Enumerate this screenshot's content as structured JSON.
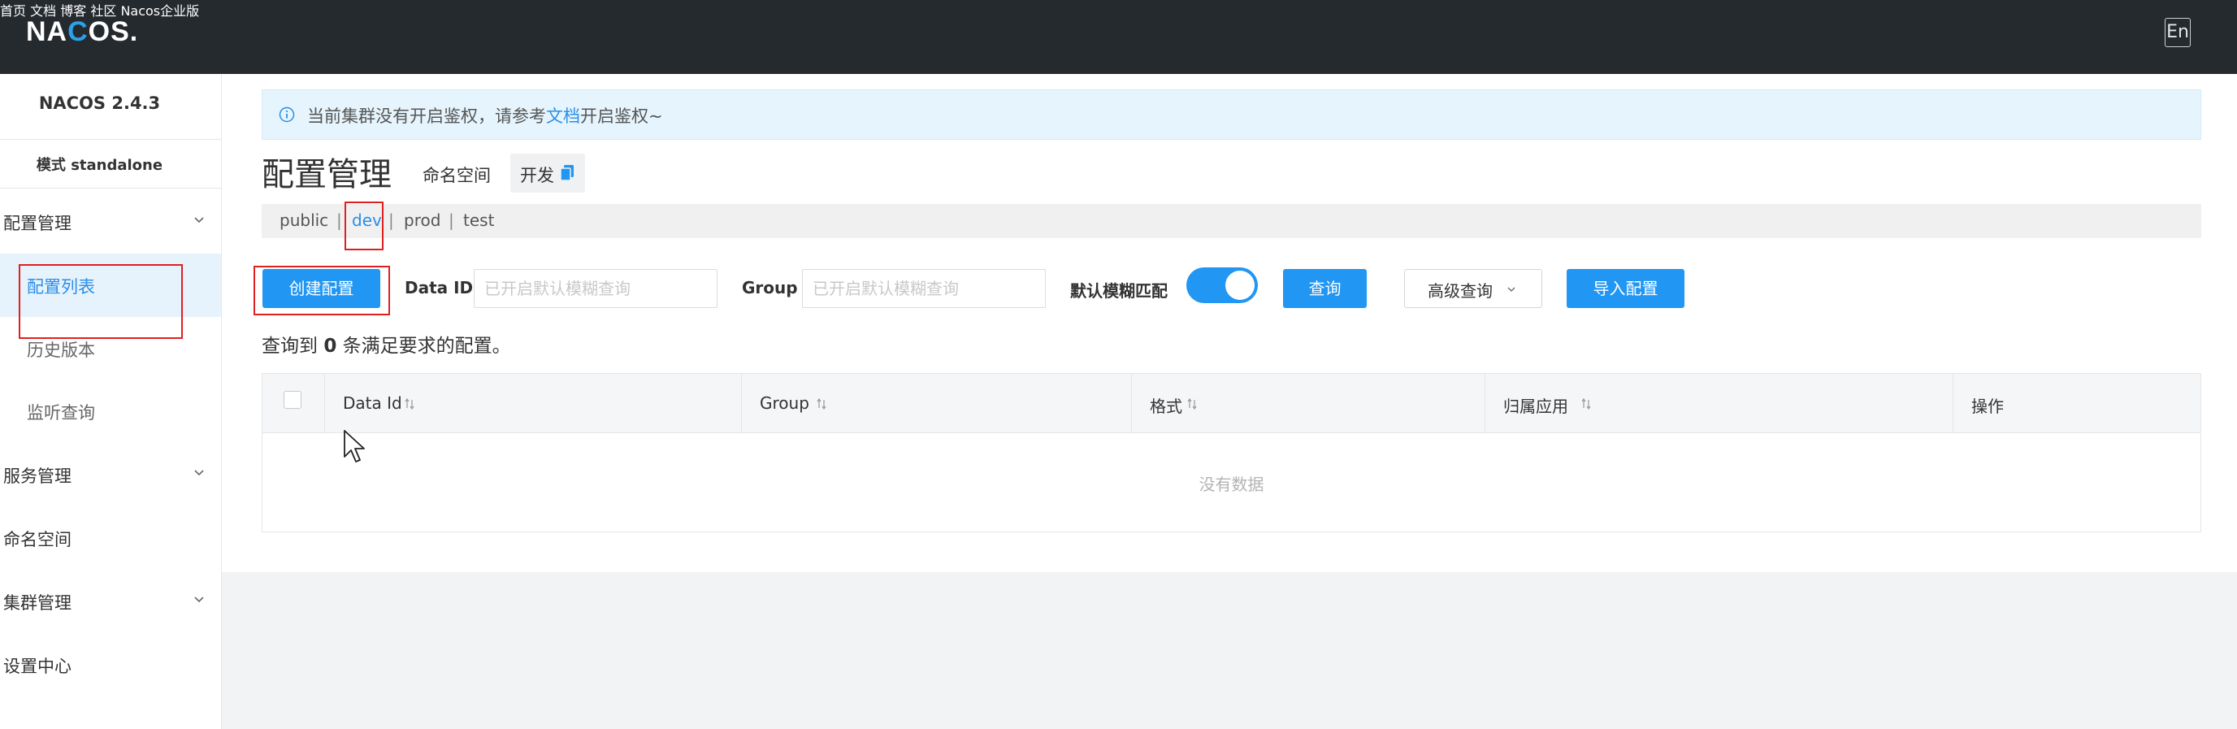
{
  "header": {
    "logo": "NACOS.",
    "logo_parts": [
      "NA",
      "C",
      "OS."
    ],
    "nav": [
      "首页",
      "文档",
      "博客",
      "社区",
      "Nacos企业版"
    ],
    "lang": "En"
  },
  "sidebar": {
    "version": "NACOS 2.4.3",
    "mode": "模式 standalone",
    "items": [
      {
        "label": "配置管理",
        "children": [
          "配置列表",
          "历史版本",
          "监听查询"
        ]
      },
      {
        "label": "服务管理"
      },
      {
        "label": "命名空间"
      },
      {
        "label": "集群管理"
      },
      {
        "label": "设置中心"
      }
    ],
    "active_item": "配置列表"
  },
  "notice": {
    "text_before": "当前集群没有开启鉴权，请参考",
    "link": "文档",
    "text_after": "开启鉴权~"
  },
  "page": {
    "title": "配置管理",
    "namespace_label": "命名空间",
    "namespace_value": "开发"
  },
  "namespaces": [
    "public",
    "dev",
    "prod",
    "test"
  ],
  "active_namespace": "dev",
  "toolbar": {
    "create": "创建配置",
    "data_id_label": "Data ID",
    "data_id_placeholder": "已开启默认模糊查询",
    "group_label": "Group",
    "group_placeholder": "已开启默认模糊查询",
    "fuzzy_label": "默认模糊匹配",
    "fuzzy_on": true,
    "search": "查询",
    "advanced": "高级查询",
    "import": "导入配置"
  },
  "result": {
    "prefix": "查询到",
    "count": "0",
    "suffix": "条满足要求的配置。"
  },
  "table": {
    "columns": [
      "Data Id",
      "Group",
      "格式",
      "归属应用",
      "操作"
    ],
    "empty": "没有数据"
  },
  "colors": {
    "accent": "#2196f3",
    "header_bg": "#252a2f",
    "highlight_box": "#e02020"
  }
}
